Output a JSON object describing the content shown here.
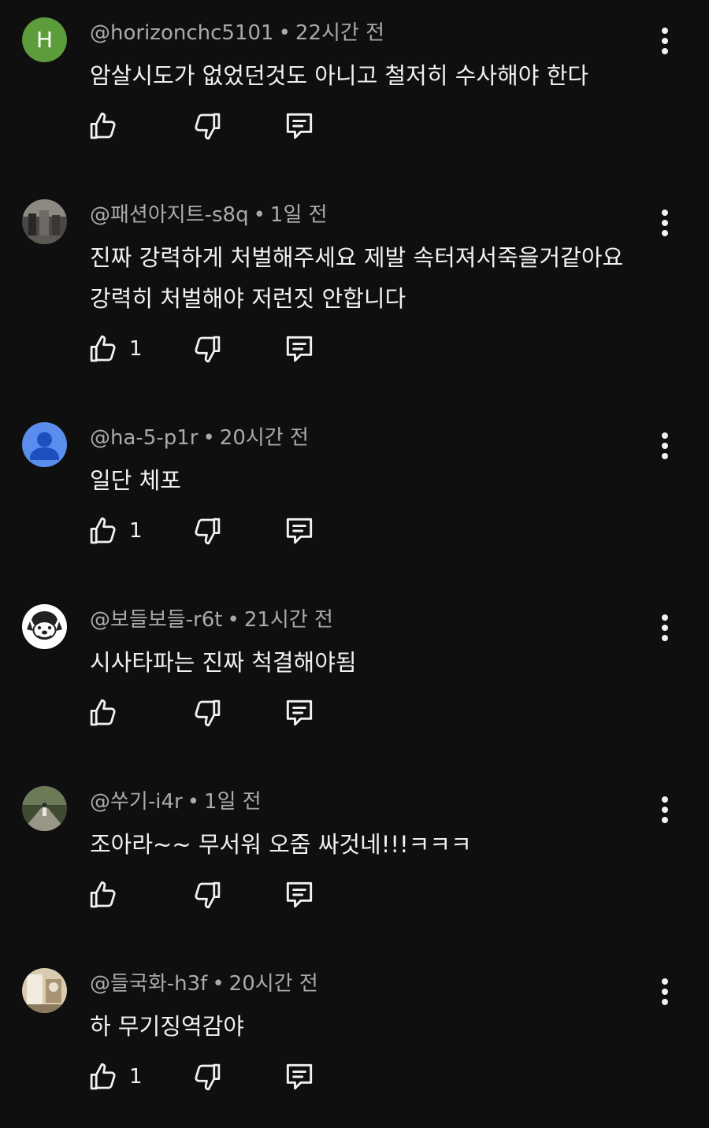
{
  "comments": [
    {
      "author": "@horizonchc5101",
      "time": "22시간 전",
      "lines": [
        "암살시도가 없었던것도 아니고 철저히 수사해야 한다"
      ],
      "likes": "",
      "avatar": {
        "type": "letter",
        "letter": "H",
        "color": "#5d9c3a"
      }
    },
    {
      "author": "@패션아지트-s8q",
      "time": "1일 전",
      "lines": [
        "진짜 강력하게 처벌해주세요 제발 속터져서죽을거같아요",
        "강력히 처벌해야  저런짓 안합니다"
      ],
      "likes": "1",
      "avatar": {
        "type": "photo",
        "color": "#6b6660"
      }
    },
    {
      "author": "@ha-5-p1r",
      "time": "20시간 전",
      "lines": [
        "일단 체포"
      ],
      "likes": "1",
      "avatar": {
        "type": "default-person",
        "color": "#5b8def"
      }
    },
    {
      "author": "@보들보들-r6t",
      "time": "21시간 전",
      "lines": [
        "시사타파는 진짜 척결해야됨"
      ],
      "likes": "",
      "avatar": {
        "type": "dog-drawing",
        "color": "#ffffff"
      }
    },
    {
      "author": "@쑤기-i4r",
      "time": "1일 전",
      "lines": [
        "조아라~~ 무서워 오줌 싸것네!!!ㅋㅋㅋ"
      ],
      "likes": "",
      "avatar": {
        "type": "photo",
        "color": "#5a6b4a"
      }
    },
    {
      "author": "@들국화-h3f",
      "time": "20시간 전",
      "lines": [
        "하 무기징역감야"
      ],
      "likes": "1",
      "avatar": {
        "type": "photo",
        "color": "#b8a88a"
      }
    }
  ],
  "icons": {
    "like": "thumb-up-icon",
    "dislike": "thumb-down-icon",
    "reply": "reply-comment-icon",
    "menu": "more-vertical-icon"
  },
  "colors": {
    "background": "#0f0f0f",
    "text": "#f1f1f1",
    "meta": "#aaaaaa"
  }
}
